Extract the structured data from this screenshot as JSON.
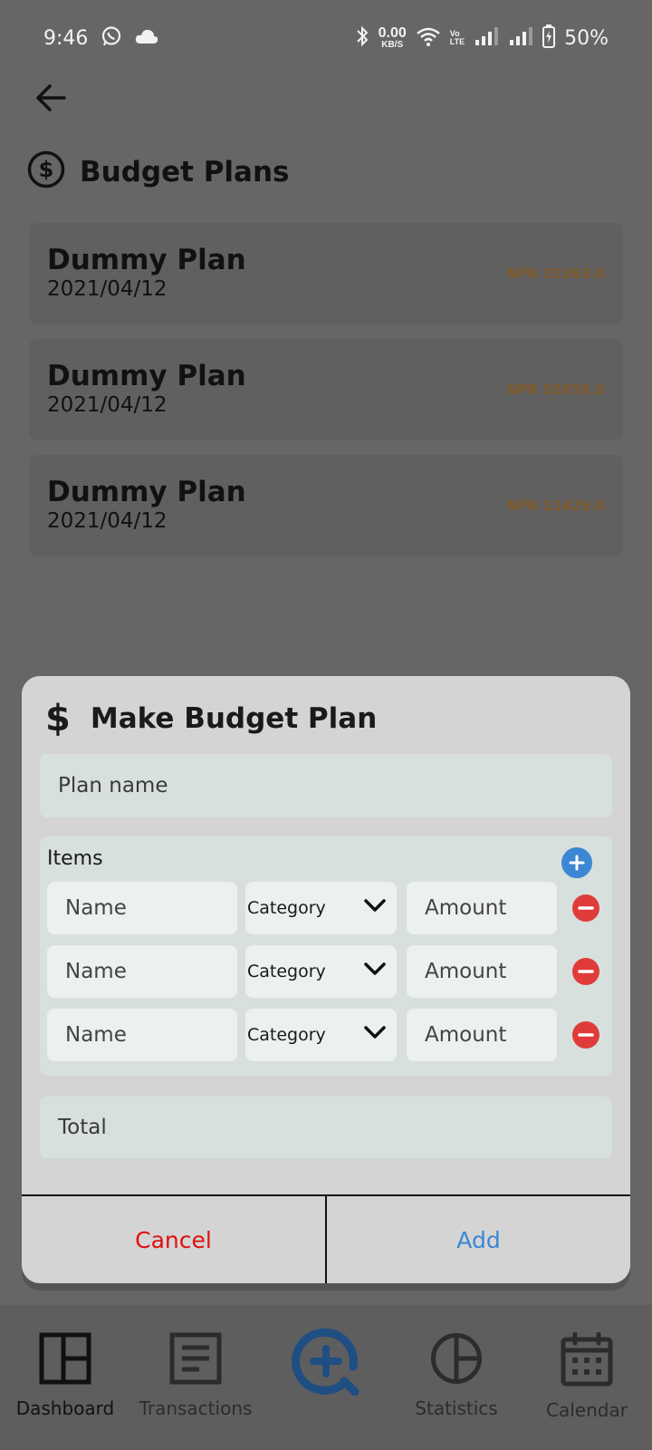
{
  "status_bar": {
    "time": "9:46",
    "net_speed_value": "0.00",
    "net_speed_unit": "KB/S",
    "volte_top": "Vo",
    "volte_bottom": "LTE",
    "battery": "50%",
    "icons": [
      "whatsapp-icon",
      "cloud-icon",
      "bluetooth-icon",
      "wifi-icon",
      "signal-icon",
      "signal-icon",
      "battery-icon"
    ]
  },
  "page": {
    "title": "Budget Plans",
    "icon": "dollar-circle-icon"
  },
  "plans": [
    {
      "name": "Dummy Plan",
      "date": "2021/04/12",
      "amount": "NPR 32363.0"
    },
    {
      "name": "Dummy Plan",
      "date": "2021/04/12",
      "amount": "NPR 55858.0"
    },
    {
      "name": "Dummy Plan",
      "date": "2021/04/12",
      "amount": "NPR 11429.0"
    }
  ],
  "dialog": {
    "title": "Make Budget Plan",
    "title_glyph": "$",
    "plan_name_placeholder": "Plan name",
    "items_label": "Items",
    "items": [
      {
        "name_placeholder": "Name",
        "category": "Category",
        "amount_placeholder": "Amount"
      },
      {
        "name_placeholder": "Name",
        "category": "Category",
        "amount_placeholder": "Amount"
      },
      {
        "name_placeholder": "Name",
        "category": "Category",
        "amount_placeholder": "Amount"
      }
    ],
    "total_placeholder": "Total",
    "cancel_label": "Cancel",
    "add_label": "Add",
    "colors": {
      "add": "#3b87d4",
      "remove": "#e03b3b",
      "cancel": "#e01010"
    }
  },
  "bottom_nav": {
    "items": [
      {
        "label": "Dashboard",
        "icon": "dashboard-icon",
        "active": true
      },
      {
        "label": "Transactions",
        "icon": "transactions-icon",
        "active": false
      },
      {
        "label": "",
        "icon": "add-search-icon",
        "active": false
      },
      {
        "label": "Statistics",
        "icon": "pie-chart-icon",
        "active": false
      },
      {
        "label": "Calendar",
        "icon": "calendar-icon",
        "active": false
      }
    ],
    "fab_color": "#1f4e82"
  }
}
